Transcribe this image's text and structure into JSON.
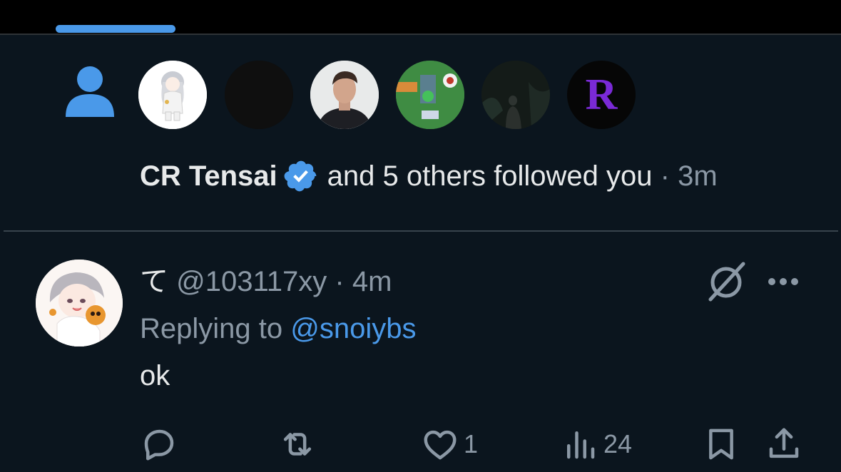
{
  "theme": {
    "background": "#0b151e",
    "accent": "#4a99e9",
    "muted_text": "#8b98a5",
    "primary_text": "#e7e9ea"
  },
  "tabs": {
    "active_indicator": "active-tab"
  },
  "follow_notification": {
    "icon": "person-icon",
    "avatars": [
      "avatar-anime-white",
      "avatar-dark",
      "avatar-man-portrait",
      "avatar-game-scene",
      "avatar-dark-forest",
      "avatar-letter-R"
    ],
    "avatar_letter": "R",
    "name": "CR Tensai",
    "verified": true,
    "text": "and 5 others followed you",
    "separator": "·",
    "time": "3m"
  },
  "reply": {
    "display_name": "て",
    "handle": "@103117xy",
    "separator": "·",
    "time": "4m",
    "replying_prefix": "Replying to",
    "replying_handle": "@snoiybs",
    "text": "ok",
    "actions": {
      "reply_count": "",
      "retweet_count": "",
      "like_count": "1",
      "views_count": "24"
    }
  }
}
